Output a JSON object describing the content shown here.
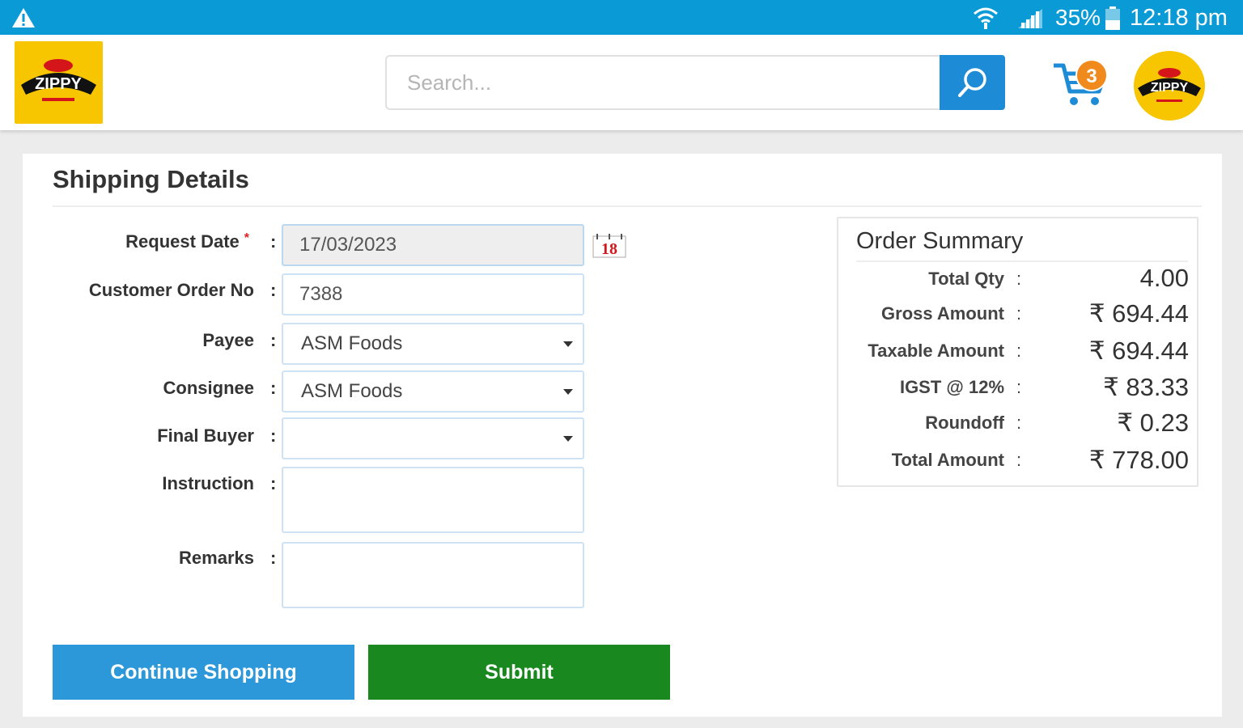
{
  "status_bar": {
    "battery_percent": "35%",
    "time": "12:18 pm"
  },
  "header": {
    "logo_text": "ZIPPY",
    "search": {
      "placeholder": "Search...",
      "value": ""
    },
    "cart_count": "3"
  },
  "shipping": {
    "title": "Shipping Details",
    "fields": {
      "request_date": {
        "label": "Request Date",
        "value": "17/03/2023",
        "required_mark": "*"
      },
      "customer_order_no": {
        "label": "Customer Order No",
        "value": "7388"
      },
      "payee": {
        "label": "Payee",
        "value": "ASM Foods"
      },
      "consignee": {
        "label": "Consignee",
        "value": "ASM Foods"
      },
      "final_buyer": {
        "label": "Final Buyer",
        "value": ""
      },
      "instruction": {
        "label": "Instruction",
        "value": ""
      },
      "remarks": {
        "label": "Remarks",
        "value": ""
      }
    },
    "colon": ":",
    "calendar_icon_text": "18",
    "buttons": {
      "continue": "Continue Shopping",
      "submit": "Submit"
    }
  },
  "order_summary": {
    "title": "Order Summary",
    "rows": [
      {
        "label": "Total Qty",
        "value": "4.00"
      },
      {
        "label": "Gross Amount",
        "value": "₹ 694.44"
      },
      {
        "label": "Taxable Amount",
        "value": "₹ 694.44"
      },
      {
        "label": "IGST @ 12%",
        "value": "₹ 83.33"
      },
      {
        "label": "Roundoff",
        "value": "₹ 0.23"
      },
      {
        "label": "Total Amount",
        "value": "₹ 778.00"
      }
    ]
  },
  "colors": {
    "status_bar": "#0a9bd6",
    "brand_yellow": "#f7c600",
    "search_button": "#1d8bd6",
    "continue_button": "#2c97d9",
    "submit_button": "#19891f",
    "cart_badge": "#f08a1c"
  }
}
